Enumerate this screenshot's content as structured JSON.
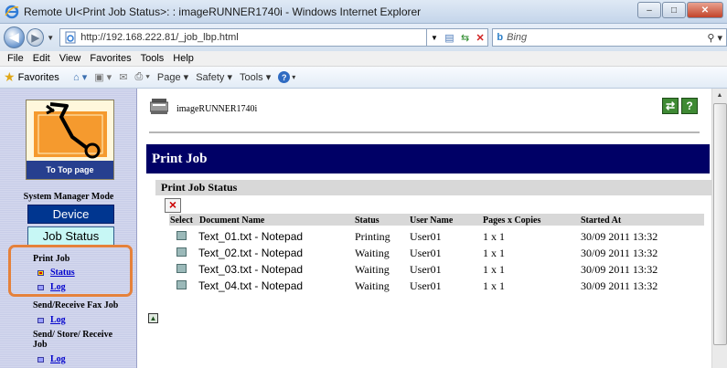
{
  "window": {
    "title": "Remote UI<Print Job Status>: : imageRUNNER1740i - Windows Internet Explorer",
    "controls": {
      "minimize": "–",
      "maximize": "□",
      "close": "✕"
    }
  },
  "browser": {
    "url": "http://192.168.222.81/_job_lbp.html",
    "search_placeholder": "Bing",
    "menu": [
      "File",
      "Edit",
      "View",
      "Favorites",
      "Tools",
      "Help"
    ],
    "favorites_label": "Favorites",
    "toolbar": {
      "page": "Page ▾",
      "safety": "Safety ▾",
      "tools": "Tools ▾"
    }
  },
  "sidebar": {
    "top_page_label": "To Top page",
    "mode_label": "System Manager Mode",
    "device_button": "Device",
    "job_status_button": "Job Status",
    "sections": [
      {
        "title": "Print Job",
        "links": [
          "Status",
          "Log"
        ]
      },
      {
        "title": "Send/Receive Fax Job",
        "links": [
          "Log"
        ]
      },
      {
        "title": "Send/ Store/ Receive",
        "title2": "Job",
        "links": [
          "Log"
        ]
      }
    ]
  },
  "main": {
    "printer_name": "imageRUNNER1740i",
    "refresh_icon_glyph": "⇄",
    "help_icon_glyph": "?",
    "banner": "Print Job",
    "subhead": "Print Job Status",
    "table": {
      "headers": [
        "Select",
        "Document Name",
        "Status",
        "User Name",
        "Pages x Copies",
        "Started At"
      ],
      "rows": [
        {
          "document": "Text_01.txt - Notepad",
          "status": "Printing",
          "user": "User01",
          "pages": "1 x 1",
          "started": "30/09 2011 13:32"
        },
        {
          "document": "Text_02.txt - Notepad",
          "status": "Waiting",
          "user": "User01",
          "pages": "1 x 1",
          "started": "30/09 2011 13:32"
        },
        {
          "document": "Text_03.txt - Notepad",
          "status": "Waiting",
          "user": "User01",
          "pages": "1 x 1",
          "started": "30/09 2011 13:32"
        },
        {
          "document": "Text_04.txt - Notepad",
          "status": "Waiting",
          "user": "User01",
          "pages": "1 x 1",
          "started": "30/09 2011 13:32"
        }
      ]
    }
  },
  "colors": {
    "banner": "#000066",
    "device_button": "#003690",
    "job_status_button": "#c7f7f5",
    "highlight": "#e5813b",
    "link": "#0000cc"
  }
}
